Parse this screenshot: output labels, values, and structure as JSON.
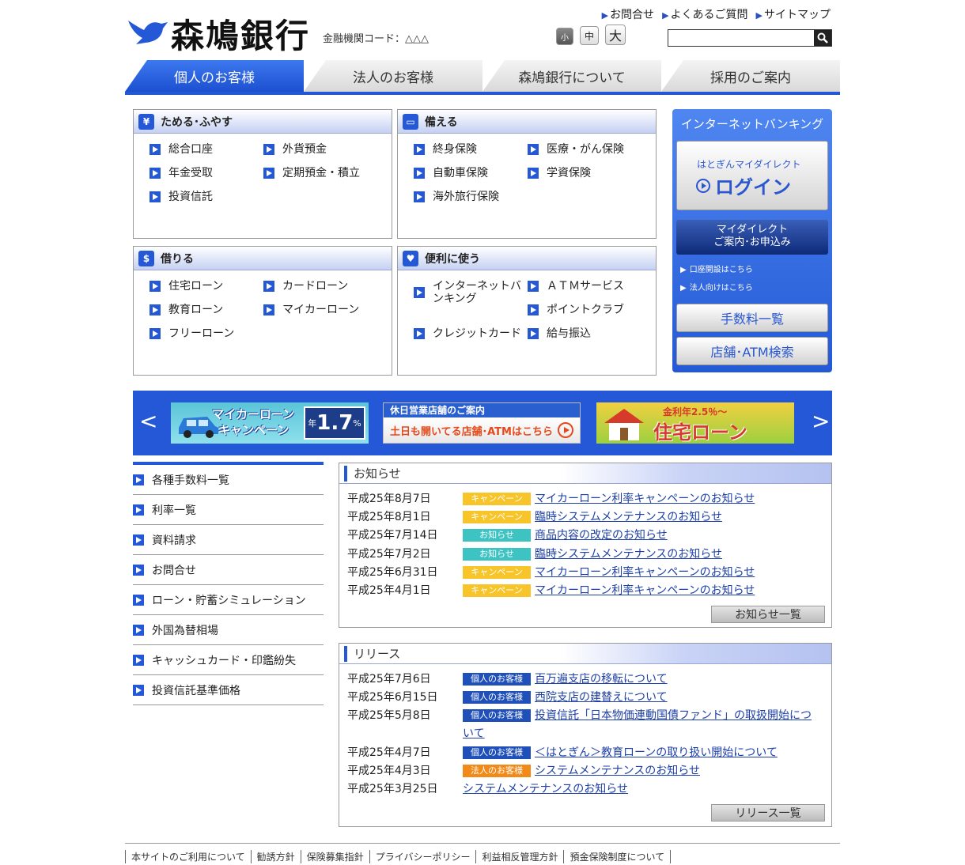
{
  "header": {
    "logo": "森鳩銀行",
    "institution_code": "金融機関コード：△△△",
    "links": [
      "お問合せ",
      "よくあるご質問",
      "サイトマップ"
    ],
    "font_sizes": [
      "小",
      "中",
      "大"
    ],
    "search_placeholder": ""
  },
  "gnav": [
    "個人のお客様",
    "法人のお客様",
    "森鳩銀行について",
    "採用のご案内"
  ],
  "categories": [
    {
      "title": "ためる･ふやす",
      "items": [
        "総合口座",
        "外貨預金",
        "年金受取",
        "定期預金・積立",
        "投資信託"
      ]
    },
    {
      "title": "備える",
      "items": [
        "終身保険",
        "医療・がん保険",
        "自動車保険",
        "学資保険",
        "海外旅行保険"
      ]
    },
    {
      "title": "借りる",
      "items": [
        "住宅ローン",
        "カードローン",
        "教育ローン",
        "マイカーローン",
        "フリーローン"
      ]
    },
    {
      "title": "便利に使う",
      "items": [
        "インターネットバンキング",
        "ＡＴＭサービス",
        "ポイントクラブ",
        "クレジットカード",
        "給与振込"
      ]
    }
  ],
  "internet_banking": {
    "title": "インターネットバンキング",
    "login_sub": "はとぎんマイダイレクト",
    "login_main": "ログイン",
    "apply_line1": "マイダイレクト",
    "apply_line2": "ご案内･お申込み",
    "links": [
      "口座開設はこちら",
      "法人向けはこちら"
    ],
    "buttons": [
      "手数料一覧",
      "店舗･ATM検索"
    ]
  },
  "banners": {
    "prev": "<",
    "next": ">",
    "car_title1": "マイカーローン",
    "car_title2": "キャンペーン",
    "car_rate_prefix": "年",
    "car_rate": "1.7",
    "car_rate_unit": "%",
    "holiday_title": "休日営業店舗のご案内",
    "holiday_sub": "土日も開いてる店舗･ATMはこちら",
    "home_rate": "金利年2.5％～",
    "home_title": "住宅ローン"
  },
  "side_menu": [
    "各種手数料一覧",
    "利率一覧",
    "資料請求",
    "お問合せ",
    "ローン・貯蓄シミュレーション",
    "外国為替相場",
    "キャッシュカード・印鑑紛失",
    "投資信託基準価格"
  ],
  "news": {
    "title": "お知らせ",
    "more": "お知らせ一覧",
    "rows": [
      {
        "date": "平成25年8月7日",
        "tag": "キャンペーン",
        "text": "マイカーローン利率キャンペーンのお知らせ"
      },
      {
        "date": "平成25年8月1日",
        "tag": "キャンペーン",
        "text": "臨時システムメンテナンスのお知らせ"
      },
      {
        "date": "平成25年7月14日",
        "tag": "お知らせ",
        "text": "商品内容の改定のお知らせ"
      },
      {
        "date": "平成25年7月2日",
        "tag": "お知らせ",
        "text": "臨時システムメンテナンスのお知らせ"
      },
      {
        "date": "平成25年6月31日",
        "tag": "キャンペーン",
        "text": "マイカーローン利率キャンペーンのお知らせ"
      },
      {
        "date": "平成25年4月1日",
        "tag": "キャンペーン",
        "text": "マイカーローン利率キャンペーンのお知らせ"
      }
    ]
  },
  "release": {
    "title": "リリース",
    "more": "リリース一覧",
    "rows": [
      {
        "date": "平成25年7月6日",
        "tag": "個人のお客様",
        "text": "百万遍支店の移転について"
      },
      {
        "date": "平成25年6月15日",
        "tag": "個人のお客様",
        "text": "西院支店の建替えについて"
      },
      {
        "date": "平成25年5月8日",
        "tag": "個人のお客様",
        "text": "投資信託「日本物価連動国債ファンド」の取扱開始につ",
        "text2": "いて"
      },
      {
        "date": "平成25年4月7日",
        "tag": "個人のお客様",
        "text": "＜はとぎん＞教育ローンの取り扱い開始について"
      },
      {
        "date": "平成25年4月3日",
        "tag": "法人のお客様",
        "text": "システムメンテナンスのお知らせ"
      },
      {
        "date": "平成25年3月25日",
        "tag": "",
        "text": "システムメンテナンスのお知らせ"
      }
    ]
  },
  "footer": [
    "本サイトのご利用について",
    "勧誘方針",
    "保険募集指針",
    "プライバシーポリシー",
    "利益相反管理方針",
    "預金保険制度について"
  ],
  "colors": {
    "brand_blue": "#2458d6",
    "campaign": "#f7c52a",
    "notice": "#3ec3c3",
    "personal": "#1f4fb8",
    "corporate": "#f28a1a"
  }
}
